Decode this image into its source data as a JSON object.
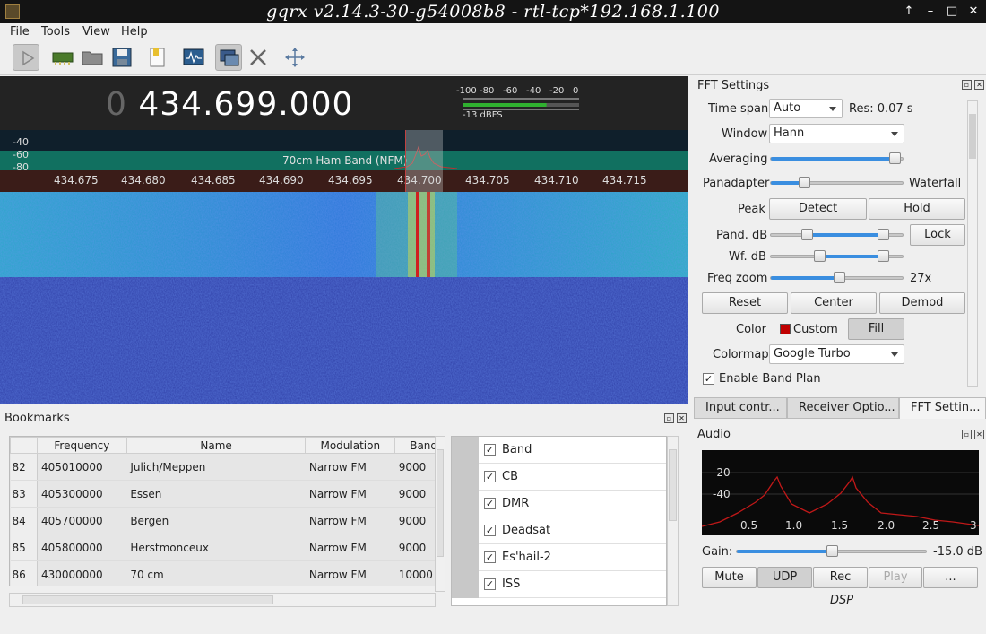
{
  "window": {
    "title": "gqrx v2.14.3-30-g54008b8 - rtl-tcp*192.168.1.100"
  },
  "menu": [
    "File",
    "Tools",
    "View",
    "Help"
  ],
  "toolbar": {
    "icons": [
      "play-icon",
      "hardware-icon",
      "open-icon",
      "save-icon",
      "bookmark-icon",
      "scope-icon",
      "io-config-icon",
      "settings-tools-icon",
      "center-icon"
    ]
  },
  "freq": {
    "prefix": "0",
    "value": "434.699.000"
  },
  "smeter": {
    "scale": [
      "-100",
      "-80",
      "-60",
      "-40",
      "-20",
      "0"
    ],
    "level": "-13 dBFS",
    "fill_fraction": 0.72
  },
  "pandapter": {
    "db": [
      "-40",
      "-60",
      "-80"
    ],
    "band_label": "70cm Ham Band (NFM)"
  },
  "scale_ticks": [
    "434.675",
    "434.680",
    "434.685",
    "434.690",
    "434.695",
    "434.700",
    "434.705",
    "434.710",
    "434.715"
  ],
  "fft": {
    "title": "FFT Settings",
    "timespan": {
      "label": "Time span",
      "value": "Auto",
      "res": "Res: 0.07 s"
    },
    "window": {
      "label": "Window",
      "value": "Hann"
    },
    "averaging": {
      "label": "Averaging",
      "fraction": 0.94
    },
    "panadapter": {
      "label": "Panadapter",
      "right": "Waterfall",
      "fraction": 0.25
    },
    "peak": {
      "label": "Peak",
      "detect": "Detect",
      "hold": "Hold"
    },
    "pand_db": {
      "label": "Pand. dB",
      "lo": 0.27,
      "hi": 0.85,
      "lock": "Lock"
    },
    "wf_db": {
      "label": "Wf. dB",
      "lo": 0.37,
      "hi": 0.85
    },
    "freqzoom": {
      "label": "Freq zoom",
      "fraction": 0.52,
      "value": "27x"
    },
    "reset": "Reset",
    "center": "Center",
    "demod": "Demod",
    "color": {
      "label": "Color",
      "name": "Custom",
      "swatch": "#c00000",
      "fill": "Fill"
    },
    "colormap": {
      "label": "Colormap",
      "value": "Google Turbo"
    },
    "bandplan": {
      "label": "Enable Band Plan",
      "checked": "✓"
    }
  },
  "tabs": [
    "Input contr...",
    "Receiver Optio...",
    "FFT Settin..."
  ],
  "bookmarks": {
    "title": "Bookmarks",
    "headers": [
      "Frequency",
      "Name",
      "Modulation",
      "Band"
    ],
    "rows": [
      {
        "n": "82",
        "freq": "405010000",
        "name": "Julich/Meppen",
        "mod": "Narrow FM",
        "bw": "9000"
      },
      {
        "n": "83",
        "freq": "405300000",
        "name": "Essen",
        "mod": "Narrow FM",
        "bw": "9000"
      },
      {
        "n": "84",
        "freq": "405700000",
        "name": "Bergen",
        "mod": "Narrow FM",
        "bw": "9000"
      },
      {
        "n": "85",
        "freq": "405800000",
        "name": "Herstmonceux",
        "mod": "Narrow FM",
        "bw": "9000"
      },
      {
        "n": "86",
        "freq": "430000000",
        "name": "70 cm",
        "mod": "Narrow FM",
        "bw": "10000"
      }
    ],
    "tags": [
      "Band",
      "CB",
      "DMR",
      "Deadsat",
      "Es'hail-2",
      "ISS"
    ]
  },
  "audio": {
    "title": "Audio",
    "db": [
      "-20",
      "-40"
    ],
    "x": [
      "0.5",
      "1.0",
      "1.5",
      "2.0",
      "2.5",
      "3"
    ],
    "gain_label": "Gain:",
    "gain_value": "-15.0 dB",
    "gain_fraction": 0.5,
    "buttons": [
      "Mute",
      "UDP",
      "Rec",
      "Play",
      "..."
    ],
    "dsp": "DSP"
  }
}
